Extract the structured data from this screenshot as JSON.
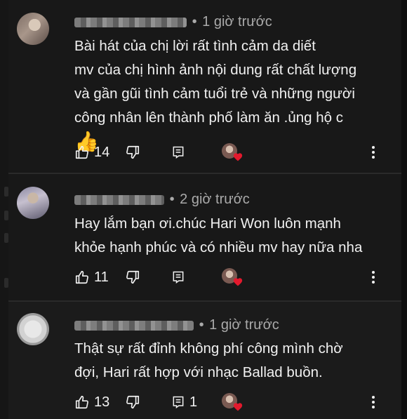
{
  "comments": [
    {
      "author": "",
      "separator": "•",
      "time": "1 giờ trước",
      "lines": [
        "Bài hát của chị lời rất tình cảm da diết",
        "mv của chị hình ảnh nội dung rất chất lượng",
        "và gần gũi tình cảm tuổi trẻ và những người",
        "công nhân lên thành phố làm ăn .ủng hộ c"
      ],
      "emoji": "👍",
      "likes": "14",
      "replies": ""
    },
    {
      "author": "",
      "separator": "•",
      "time": "2 giờ trước",
      "lines": [
        "Hay lắm bạn ơi.chúc Hari Won luôn mạnh",
        "khỏe hạnh phúc và có nhiều mv hay nữa nha"
      ],
      "emoji": "",
      "likes": "11",
      "replies": ""
    },
    {
      "author": "",
      "separator": "•",
      "time": "1 giờ trước",
      "lines": [
        "Thật sự rất đỉnh không phí công mình chờ",
        "đợi, Hari rất hợp với nhạc Ballad buồn."
      ],
      "emoji": "",
      "likes": "13",
      "replies": "1"
    }
  ],
  "icons": {
    "like": "thumbs-up-icon",
    "dislike": "thumbs-down-icon",
    "reply": "reply-icon",
    "creator_heart": "creator-heart-icon",
    "more": "more-vertical-icon"
  },
  "colors": {
    "background": "#0f0f0f",
    "card": "#181818",
    "text": "#f1f1f1",
    "meta": "#aaaaaa",
    "heart": "#e3192d"
  }
}
